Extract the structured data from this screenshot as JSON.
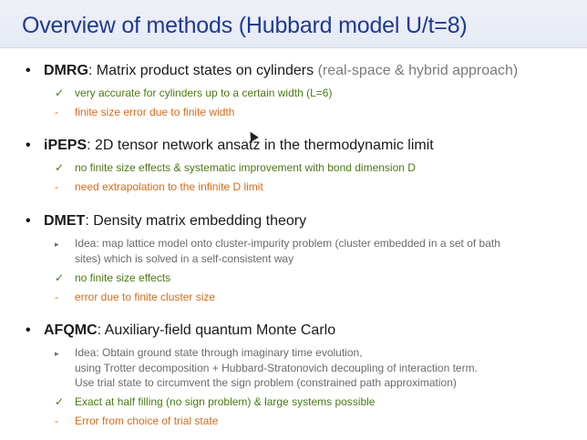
{
  "slide": {
    "title": "Overview of methods (Hubbard model U/t=8)",
    "bullet_char": "•",
    "pro_mark": "✓",
    "con_mark": "-",
    "idea_mark": "▸",
    "sections": [
      {
        "name": "DMRG",
        "desc": ": Matrix product states on cylinders",
        "paren": "(real-space & hybrid approach)",
        "points": [
          {
            "type": "pro",
            "text": "very accurate for cylinders up to a certain width (L=6)"
          },
          {
            "type": "con",
            "text": "finite size error due to finite width"
          }
        ]
      },
      {
        "name": "iPEPS",
        "desc": ": 2D tensor network ansatz in the thermodynamic limit",
        "points": [
          {
            "type": "pro",
            "text": "no finite size effects & systematic improvement with bond dimension D"
          },
          {
            "type": "con",
            "text": "need extrapolation to the infinite D limit"
          }
        ]
      },
      {
        "name": "DMET",
        "desc": ": Density matrix embedding theory",
        "idea": [
          "Idea: map lattice model onto cluster-impurity problem (cluster embedded in a set of bath",
          "sites) which is solved in a self-consistent way"
        ],
        "points": [
          {
            "type": "pro",
            "text": "no finite size effects"
          },
          {
            "type": "con",
            "text": "error due to finite cluster size"
          }
        ]
      },
      {
        "name": "AFQMC",
        "desc": ": Auxiliary-field quantum Monte Carlo",
        "idea": [
          "Idea: Obtain ground state through imaginary time evolution,",
          "using Trotter decomposition + Hubbard-Stratonovich decoupling of interaction term.",
          "Use trial state to circumvent the sign problem (constrained path approximation)"
        ],
        "points": [
          {
            "type": "pro",
            "text": "Exact at half filling (no sign problem) & large systems possible"
          },
          {
            "type": "con",
            "text": "Error from choice of trial state"
          }
        ]
      }
    ]
  }
}
